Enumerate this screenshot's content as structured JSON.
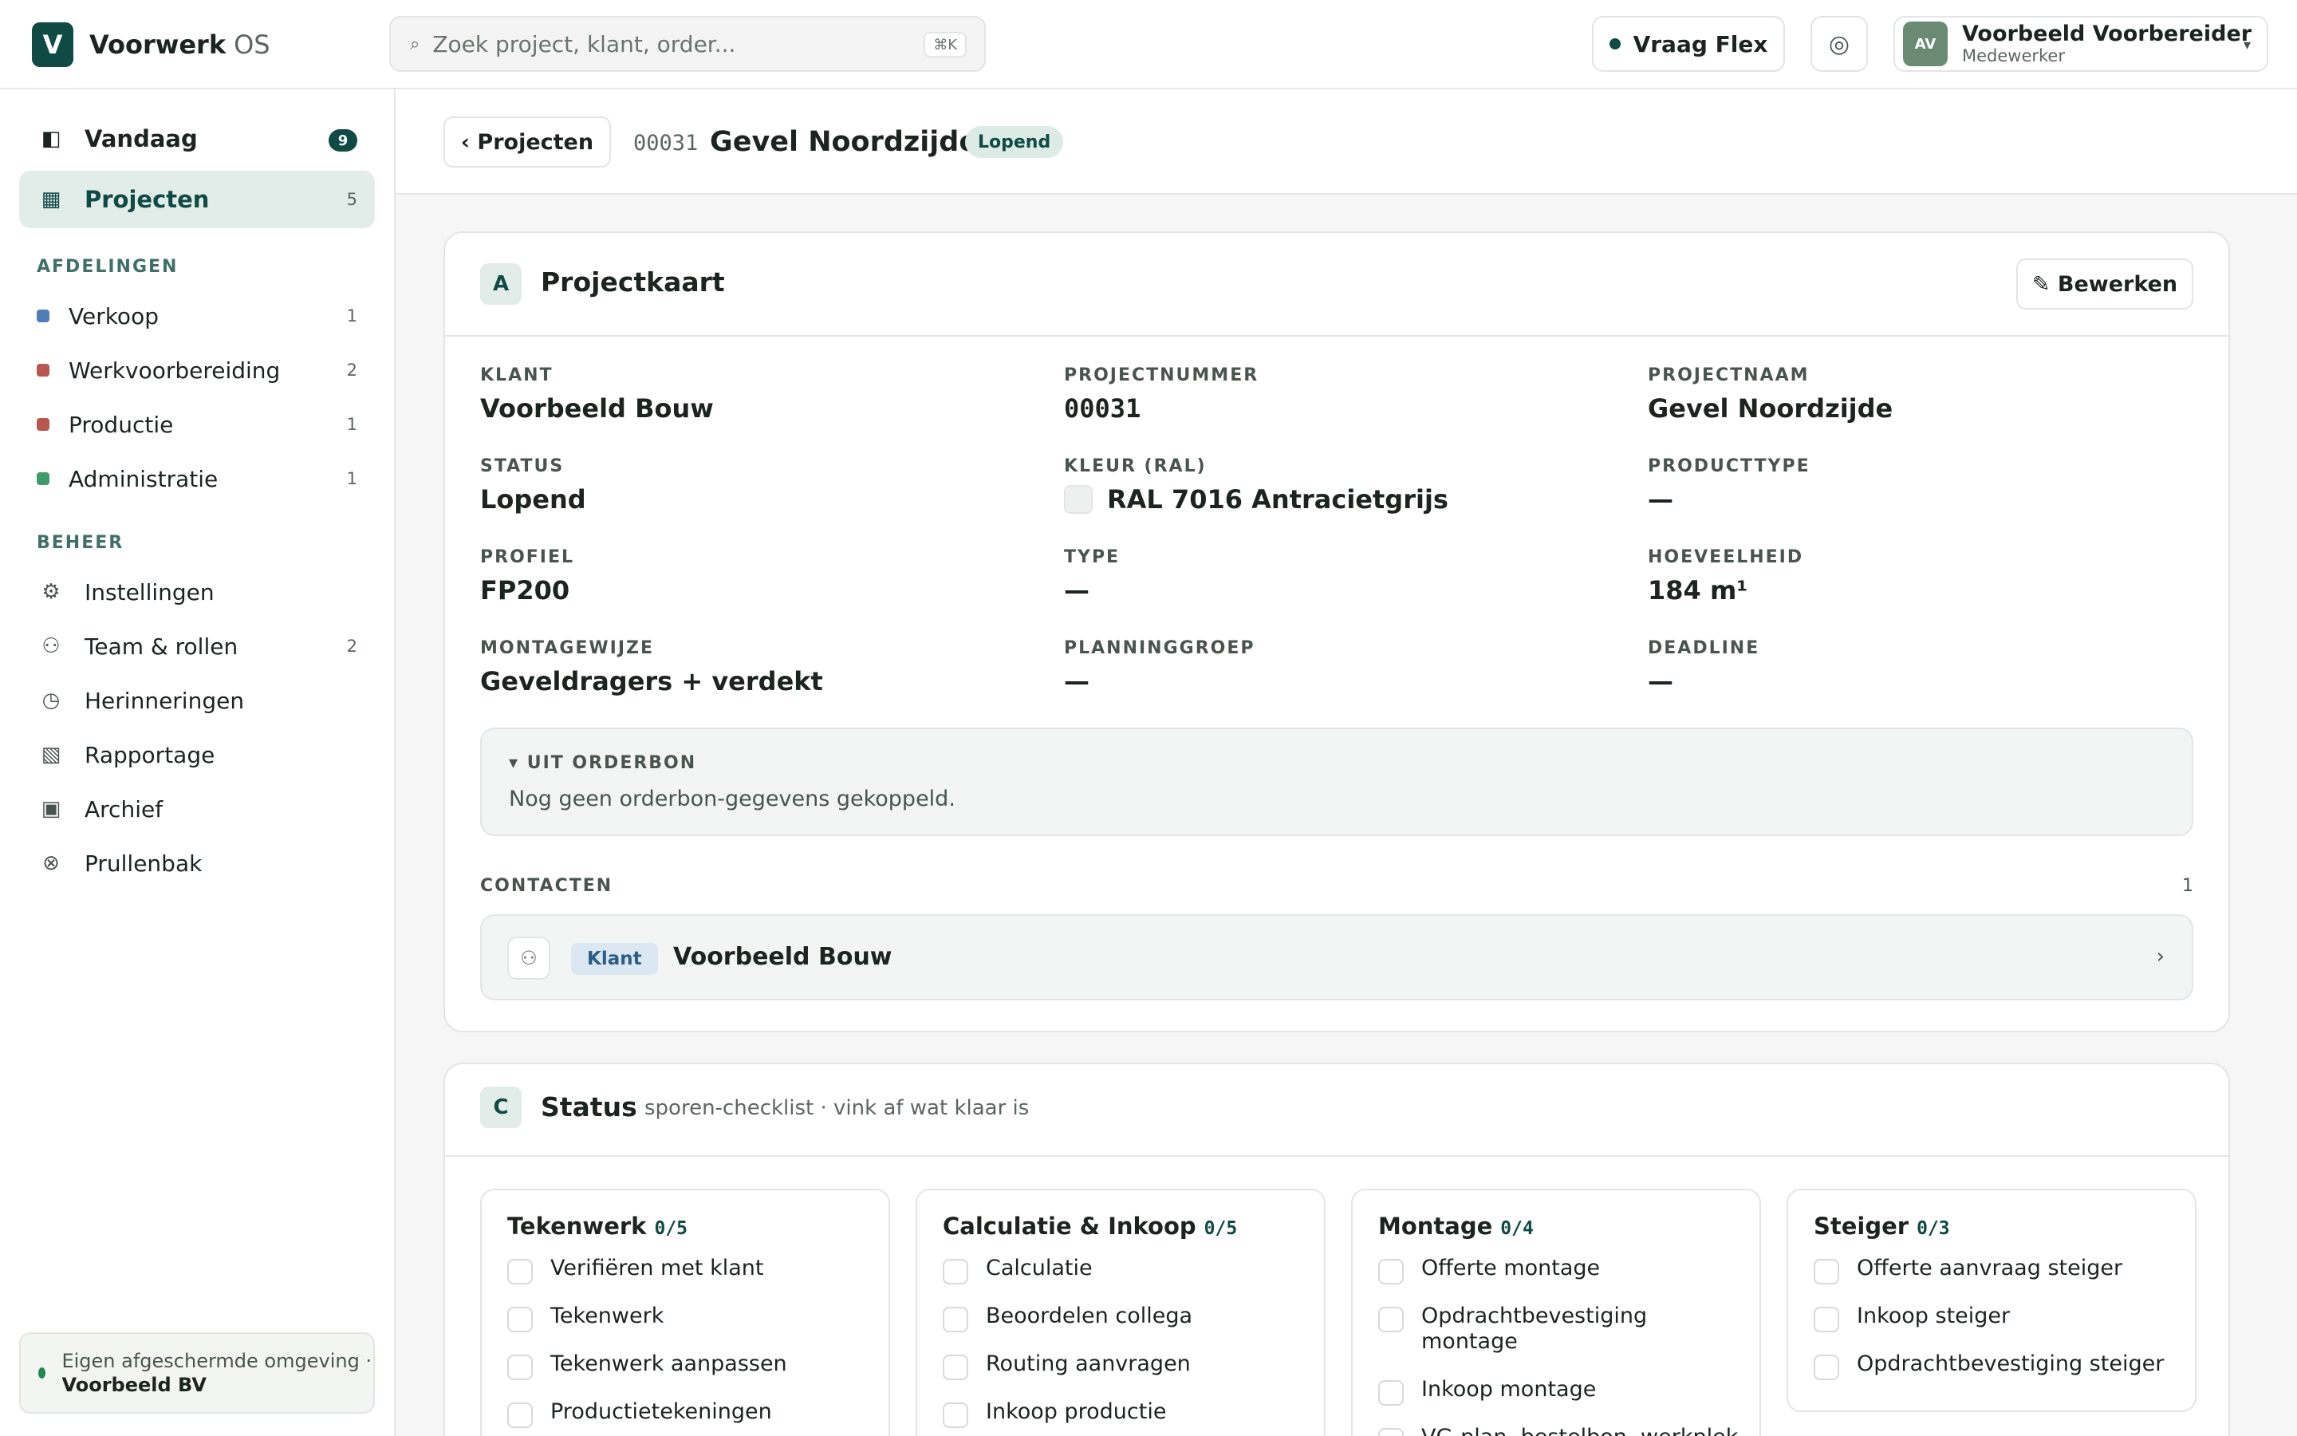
{
  "brand": {
    "logo_letter": "V",
    "name": "Voorwerk",
    "suffix": "OS"
  },
  "search": {
    "placeholder": "Zoek project, klant, order...",
    "shortcut": "⌘K",
    "icon": "search-icon"
  },
  "header_actions": {
    "flex_label": "Vraag Flex",
    "target_icon": "◎",
    "user": {
      "initials": "AV",
      "name": "Voorbeeld Voorbereider",
      "role": "Medewerker",
      "caret": "▾"
    }
  },
  "sidebar": {
    "primary": [
      {
        "icon": "◧",
        "label": "Vandaag",
        "badge": "9"
      },
      {
        "icon": "▦",
        "label": "Projecten",
        "count": "5"
      }
    ],
    "departments_title": "AFDELINGEN",
    "departments": [
      {
        "label": "Verkoop",
        "count": "1",
        "color": "#4f7db8"
      },
      {
        "label": "Werkvoorbereiding",
        "count": "2",
        "color": "#b8574f"
      },
      {
        "label": "Productie",
        "count": "1",
        "color": "#b8574f"
      },
      {
        "label": "Administratie",
        "count": "1",
        "color": "#3f9b6a"
      }
    ],
    "management_title": "BEHEER",
    "management": [
      {
        "icon": "⚙",
        "label": "Instellingen",
        "count": ""
      },
      {
        "icon": "⚇",
        "label": "Team & rollen",
        "count": "2"
      },
      {
        "icon": "◷",
        "label": "Herinneringen",
        "count": ""
      },
      {
        "icon": "▧",
        "label": "Rapportage",
        "count": ""
      },
      {
        "icon": "▣",
        "label": "Archief",
        "count": ""
      },
      {
        "icon": "⊗",
        "label": "Prullenbak",
        "count": ""
      }
    ],
    "environment": {
      "text": "Eigen afgeschermde omgeving · ",
      "org": "Voorbeeld BV"
    }
  },
  "page_header": {
    "back_label": "‹ Projecten",
    "project_number": "00031",
    "project_title": "Gevel Noordzijde",
    "status_pill": "Lopend"
  },
  "project_card": {
    "letter": "A",
    "title": "Projectkaart",
    "edit_label": "✎ Bewerken",
    "fields": [
      {
        "label": "KLANT",
        "value": "Voorbeeld Bouw"
      },
      {
        "label": "PROJECTNUMMER",
        "value": "00031"
      },
      {
        "label": "PROJECTNAAM",
        "value": "Gevel Noordzijde"
      },
      {
        "label": "STATUS",
        "value": "Lopend"
      },
      {
        "label": "KLEUR (RAL)",
        "value": "RAL 7016 Antracietgrijs"
      },
      {
        "label": "PRODUCTTYPE",
        "value": "—"
      },
      {
        "label": "PROFIEL",
        "value": "FP200"
      },
      {
        "label": "TYPE",
        "value": "—"
      },
      {
        "label": "HOEVEELHEID",
        "value": "184 m¹"
      },
      {
        "label": "MONTAGEWIJZE",
        "value": "Geveldragers + verdekt"
      },
      {
        "label": "PLANNINGGROEP",
        "value": "—"
      },
      {
        "label": "DEADLINE",
        "value": "—"
      }
    ],
    "orderbon": {
      "title": "▾ UIT ORDERBON",
      "text": "Nog geen orderbon-gegevens gekoppeld."
    },
    "contacts": {
      "label": "CONTACTEN",
      "count": "1",
      "items": [
        {
          "icon": "⚇",
          "tag": "Klant",
          "name": "Voorbeeld Bouw",
          "chevron": "›"
        }
      ]
    }
  },
  "status_card": {
    "letter": "C",
    "title": "Status",
    "subtitle": "sporen-checklist · vink af wat klaar is",
    "lanes": [
      {
        "title": "Tekenwerk",
        "count": "0/5",
        "tasks": [
          "Verifiëren met klant",
          "Tekenwerk",
          "Tekenwerk aanpassen",
          "Productietekeningen"
        ]
      },
      {
        "title": "Calculatie & Inkoop",
        "count": "0/5",
        "tasks": [
          "Calculatie",
          "Beoordelen collega",
          "Routing aanvragen",
          "Inkoop productie"
        ]
      },
      {
        "title": "Montage",
        "count": "0/4",
        "tasks": [
          "Offerte montage",
          "Opdrachtbevestiging montage",
          "Inkoop montage",
          "VG-plan, bestelbon, werkplek"
        ]
      },
      {
        "title": "Steiger",
        "count": "0/3",
        "tasks": [
          "Offerte aanvraag steiger",
          "Inkoop steiger",
          "Opdrachtbevestiging steiger"
        ]
      }
    ]
  },
  "colors": {
    "accent": "#0f4a45",
    "accent_soft": "#e2ece9",
    "tag_blue": "#dbe8f3"
  }
}
